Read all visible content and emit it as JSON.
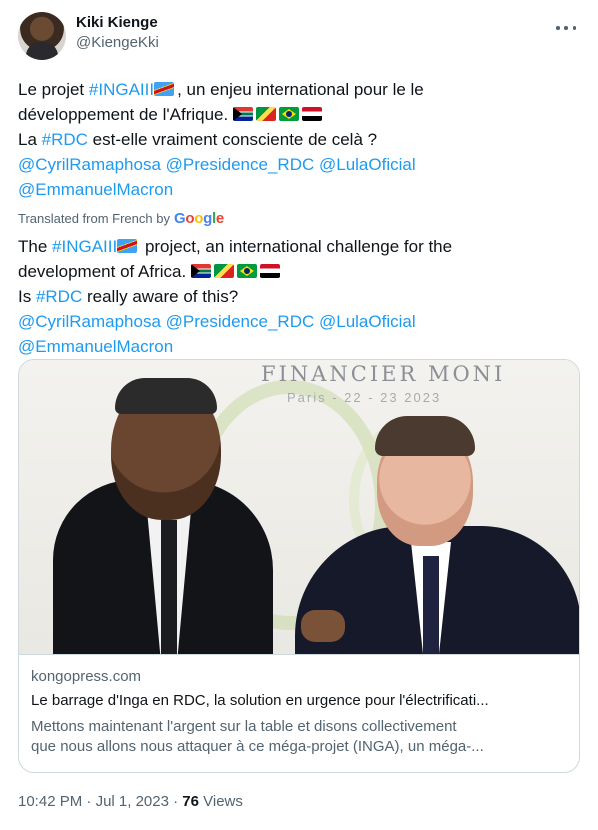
{
  "author": {
    "display_name": "Kiki Kienge",
    "handle": "@KiengeKki"
  },
  "tweet": {
    "original": {
      "line1_prefix": "Le projet ",
      "hashtag_inga": "#INGAIII",
      "line1_suffix": ", un enjeu international pour le le",
      "line2": "développement de l'Afrique. ",
      "line3_prefix": "La ",
      "hashtag_rdc": "#RDC",
      "line3_suffix": " est-elle vraiment consciente de celà ?",
      "mention_1": "@CyrilRamaphosa",
      "mention_2": "@Presidence_RDC",
      "mention_3": "@LulaOficial",
      "mention_4": "@EmmanuelMacron"
    },
    "translation_label": "Translated from French by",
    "translation_provider": "Google",
    "translated": {
      "line1_prefix": "The ",
      "hashtag_inga": "#INGAIII",
      "line1_suffix": " project, an international challenge for the",
      "line2": "development of Africa. ",
      "line3_prefix": "Is ",
      "hashtag_rdc": "#RDC",
      "line3_suffix": " really aware of this?",
      "mention_1": "@CyrilRamaphosa",
      "mention_2": "@Presidence_RDC",
      "mention_3": "@LulaOficial",
      "mention_4": "@EmmanuelMacron"
    },
    "flags": [
      "flag-dr-congo",
      "flag-south-africa",
      "flag-congo",
      "flag-brazil",
      "flag-egypt"
    ]
  },
  "link_card": {
    "banner_text": "FINANCIER MONI",
    "banner_subtext": "Paris - 22 - 23 2023",
    "domain": "kongopress.com",
    "title": "Le barrage d'Inga en RDC, la solution en urgence pour l'électrificati...",
    "description_line1": "Mettons maintenant l'argent sur la table et disons collectivement",
    "description_line2": "que nous allons nous attaquer à ce méga-projet (INGA), un méga-..."
  },
  "footer": {
    "time": "10:42 PM",
    "separator": " · ",
    "date": "Jul 1, 2023",
    "views_count": "76",
    "views_label": " Views"
  },
  "colors": {
    "link": "#1d9bf0",
    "secondary_text": "#536471",
    "primary_text": "#0f1419",
    "border": "#cfd9de"
  }
}
